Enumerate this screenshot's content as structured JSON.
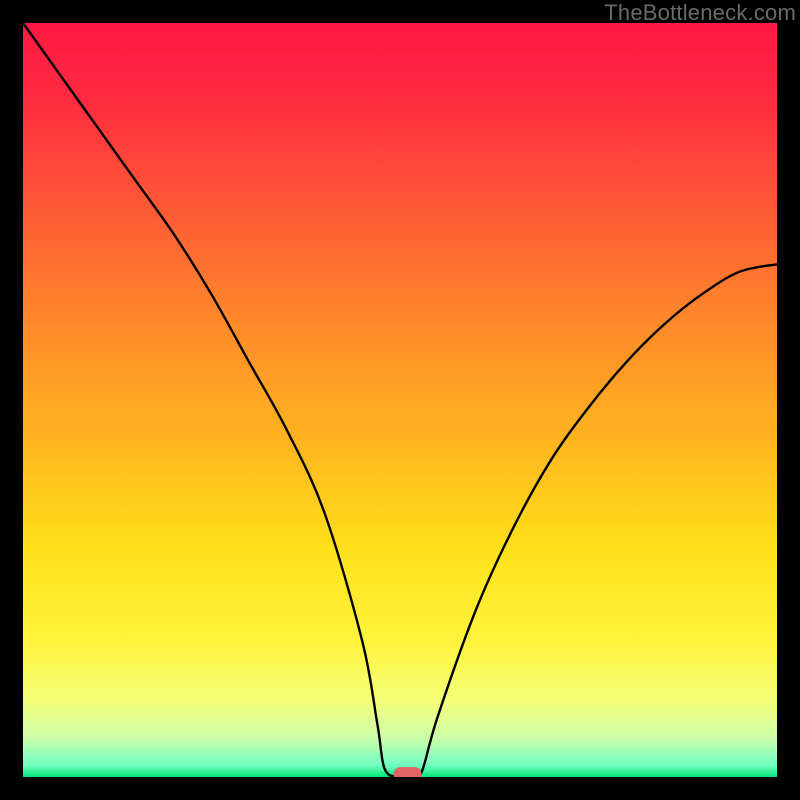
{
  "watermark": "TheBottleneck.com",
  "chart_data": {
    "type": "line",
    "title": "",
    "xlabel": "",
    "ylabel": "",
    "xlim": [
      0,
      100
    ],
    "ylim": [
      0,
      100
    ],
    "series": [
      {
        "name": "bottleneck-curve",
        "x": [
          0,
          5,
          10,
          15,
          20,
          25,
          30,
          35,
          40,
          45,
          47,
          48,
          50,
          52,
          53,
          55,
          60,
          65,
          70,
          75,
          80,
          85,
          90,
          95,
          100
        ],
        "y": [
          100,
          93,
          86,
          79,
          72,
          64,
          55,
          46,
          35,
          18,
          7,
          1,
          0,
          0,
          1,
          8,
          22,
          33,
          42,
          49,
          55,
          60,
          64,
          67,
          68
        ]
      }
    ],
    "marker": {
      "x": 51,
      "y": 0.4
    },
    "gradient_stops": [
      {
        "offset": 0.0,
        "color": "#ff1744"
      },
      {
        "offset": 0.1,
        "color": "#ff2b3f"
      },
      {
        "offset": 0.25,
        "color": "#ff5a36"
      },
      {
        "offset": 0.4,
        "color": "#ff8a2a"
      },
      {
        "offset": 0.55,
        "color": "#ffb31f"
      },
      {
        "offset": 0.7,
        "color": "#ffe11a"
      },
      {
        "offset": 0.82,
        "color": "#fff33d"
      },
      {
        "offset": 0.9,
        "color": "#f4ff7a"
      },
      {
        "offset": 0.95,
        "color": "#c9ffab"
      },
      {
        "offset": 0.985,
        "color": "#6fffc2"
      },
      {
        "offset": 1.0,
        "color": "#00e676"
      }
    ],
    "curve_color": "#000000",
    "marker_color": "#e06666"
  }
}
